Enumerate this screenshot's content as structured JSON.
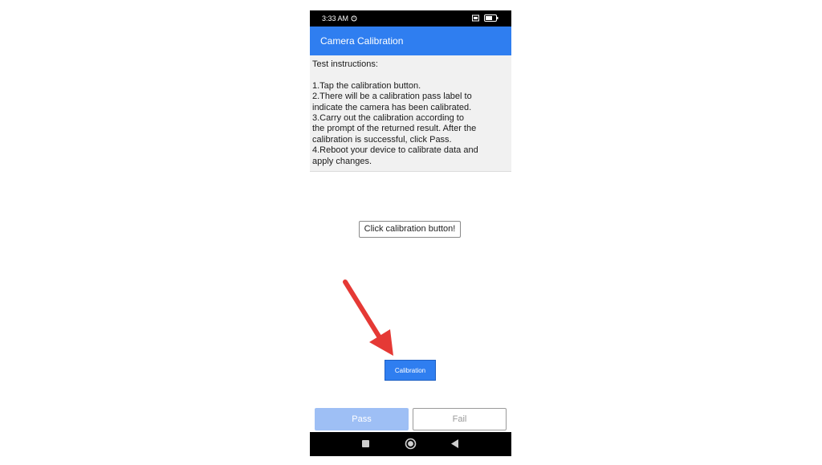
{
  "status_bar": {
    "time": "3:33 AM",
    "battery": "58"
  },
  "app_bar": {
    "title": "Camera Calibration"
  },
  "instructions": {
    "heading": "Test instructions:",
    "lines": [
      "1.Tap the calibration button.",
      "2.There will be a calibration pass label to",
      "indicate the camera has been calibrated.",
      "3.Carry out the calibration according to",
      "the prompt of the returned result. After the",
      "calibration is successful, click Pass.",
      "4.Reboot your device to calibrate data and",
      "apply changes."
    ]
  },
  "result_label": {
    "text": "Click calibration button!"
  },
  "calibration_button": {
    "label": "Calibration"
  },
  "footer": {
    "pass_label": "Pass",
    "fail_label": "Fail"
  },
  "colors": {
    "accent": "#2f7ef0",
    "pass_disabled": "#9ebff5",
    "annotation_arrow": "#e53935"
  },
  "icons": {
    "alarm": "alarm-icon",
    "battery": "battery-icon",
    "nav_recents": "recents-square-icon",
    "nav_home": "home-circle-icon",
    "nav_back": "back-triangle-icon"
  }
}
